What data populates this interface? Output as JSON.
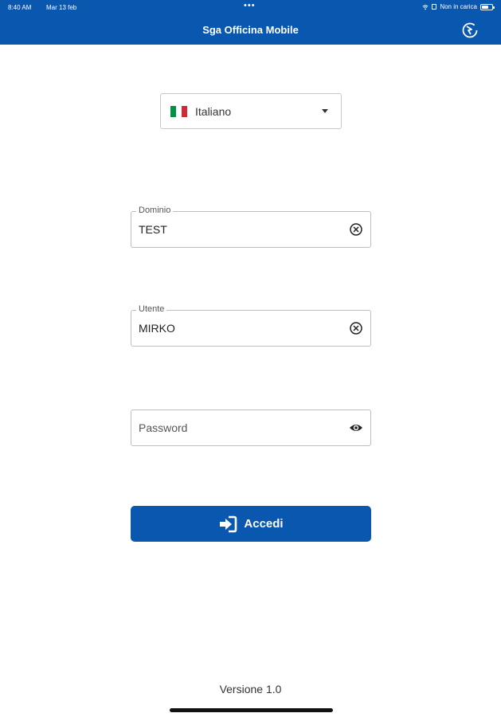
{
  "status_bar": {
    "time": "8:40 AM",
    "date": "Mar 13 feb",
    "dots": "•••",
    "charging_text": "Non in carica",
    "battery_level": 0.7,
    "icons": [
      "wifi-icon",
      "lock-icon",
      "battery-icon"
    ]
  },
  "header": {
    "title": "Sga Officina Mobile",
    "action_icon": "refresh-settings-icon"
  },
  "language": {
    "selected": "Italiano",
    "flag_colors": [
      "#009246",
      "#ffffff",
      "#ce2b37"
    ]
  },
  "form": {
    "domain": {
      "label": "Dominio",
      "value": "TEST"
    },
    "user": {
      "label": "Utente",
      "value": "MIRKO"
    },
    "password": {
      "placeholder": "Password",
      "value": ""
    }
  },
  "login_button": {
    "label": "Accedi"
  },
  "footer": {
    "version": "Versione 1.0"
  },
  "colors": {
    "accent": "#0a57b0"
  }
}
